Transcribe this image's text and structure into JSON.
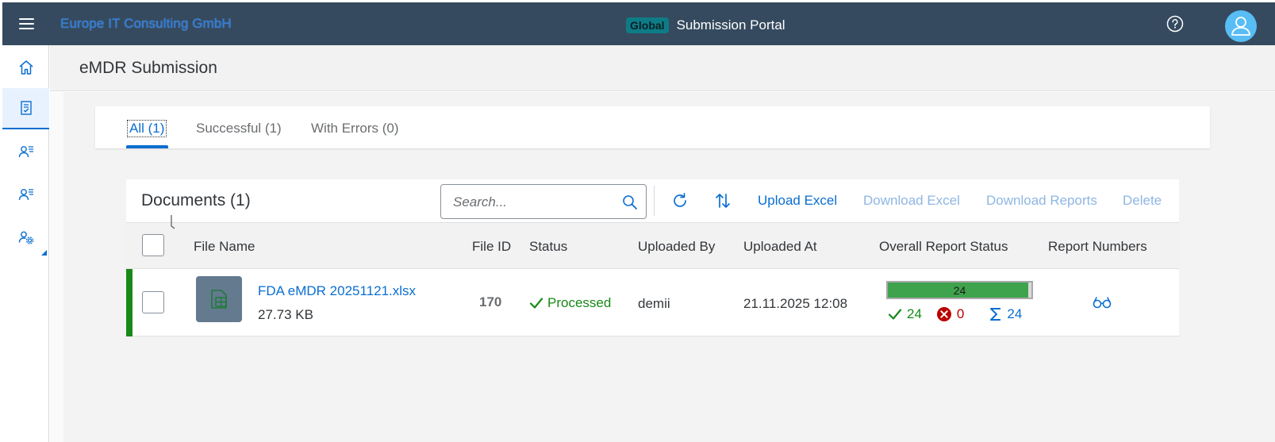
{
  "shell": {
    "company": "Europe IT Consulting GmbH",
    "badge": "Global",
    "title": "Submission Portal",
    "icons": [
      "menu-icon",
      "help-icon",
      "user-icon"
    ]
  },
  "sidenav": {
    "items": [
      {
        "name": "home",
        "icon": "home-icon"
      },
      {
        "name": "submissions",
        "icon": "clipboard-check-icon",
        "active": true
      },
      {
        "name": "users",
        "icon": "user-list-icon"
      },
      {
        "name": "user-roles",
        "icon": "user-list-icon"
      },
      {
        "name": "settings",
        "icon": "user-settings-icon"
      }
    ]
  },
  "page": {
    "title": "eMDR Submission"
  },
  "tabs": [
    {
      "label": "All (1)",
      "active": true
    },
    {
      "label": "Successful (1)"
    },
    {
      "label": "With Errors (0)"
    }
  ],
  "toolbar": {
    "title": "Documents (1)",
    "search_placeholder": "Search...",
    "upload_label": "Upload Excel",
    "download_excel_label": "Download Excel",
    "download_reports_label": "Download Reports",
    "delete_label": "Delete"
  },
  "table": {
    "columns": [
      "File Name",
      "File ID",
      "Status",
      "Uploaded By",
      "Uploaded At",
      "Overall Report Status",
      "Report Numbers"
    ],
    "rows": [
      {
        "file_name": "FDA eMDR 20251121.xlsx",
        "file_size": "27.73 KB",
        "file_id": "170",
        "status": "Processed",
        "uploaded_by": "demii",
        "uploaded_at": "21.11.2025 12:08",
        "progress_label": "24",
        "progress_fraction": 0.98,
        "success_count": "24",
        "error_count": "0",
        "total_count": "24"
      }
    ]
  },
  "colors": {
    "shell": "#354a5f",
    "accent": "#0a6ed1",
    "success": "#188918",
    "error": "#bb0000",
    "avatar": "#58bdf5"
  }
}
